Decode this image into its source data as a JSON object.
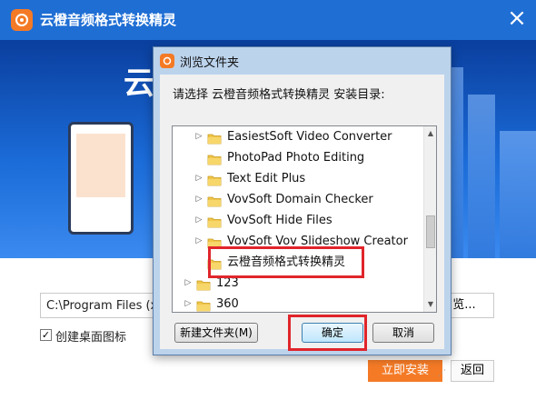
{
  "installer": {
    "title": "云橙音频格式转换精灵",
    "banner_text": "云",
    "path_value": "C:\\Program Files (x8",
    "browse_label": "览...",
    "desktop_icon_label": "创建桌面图标",
    "desktop_icon_checked": true,
    "install_label": "立即安装",
    "back_label": "返回",
    "accent_color": "#f47a26",
    "titlebar_color": "#1f6ed4"
  },
  "dialog": {
    "title": "浏览文件夹",
    "prompt": "请选择 云橙音频格式转换精灵 安装目录:",
    "tree": [
      {
        "label": "EasiestSoft Video Converter",
        "expandable": true,
        "level": 2
      },
      {
        "label": "PhotoPad Photo Editing",
        "expandable": false,
        "level": 2
      },
      {
        "label": "Text Edit Plus",
        "expandable": true,
        "level": 2
      },
      {
        "label": "VovSoft Domain Checker",
        "expandable": true,
        "level": 2
      },
      {
        "label": "VovSoft Hide Files",
        "expandable": true,
        "level": 2
      },
      {
        "label": "VovSoft Vov Slideshow Creator",
        "expandable": true,
        "level": 2
      },
      {
        "label": "云橙音频格式转换精灵",
        "expandable": false,
        "level": 2,
        "selected": true
      },
      {
        "label": "123",
        "expandable": true,
        "level": 1
      },
      {
        "label": "360",
        "expandable": true,
        "level": 1
      }
    ],
    "new_folder_label": "新建文件夹(M)",
    "ok_label": "确定",
    "cancel_label": "取消",
    "highlight_color": "#e0252b"
  }
}
